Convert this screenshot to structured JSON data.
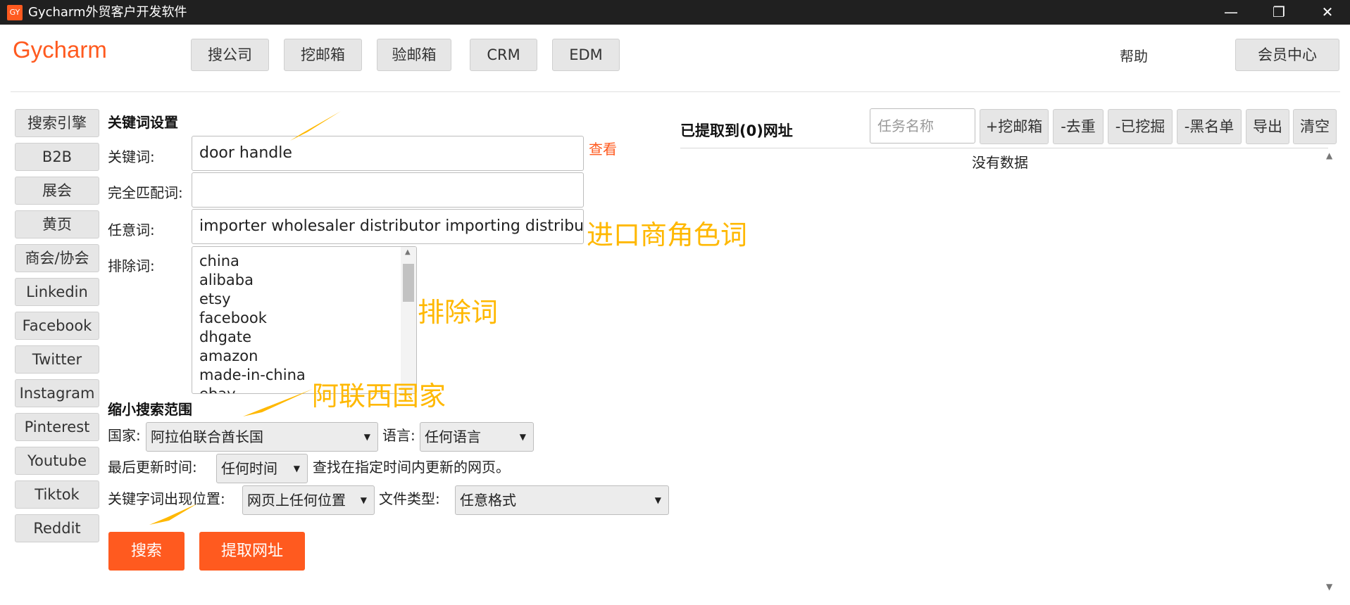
{
  "window": {
    "app_icon": "GY",
    "title": "Gycharm外贸客户开发软件",
    "controls": {
      "minimize": "—",
      "maximize": "❐",
      "close": "✕"
    }
  },
  "brand": "Gycharm",
  "nav": {
    "items": [
      "搜公司",
      "挖邮箱",
      "验邮箱",
      "CRM",
      "EDM"
    ],
    "help": "帮助",
    "member": "会员中心"
  },
  "sidebar": {
    "items": [
      "搜索引擎",
      "B2B",
      "展会",
      "黄页",
      "商会/协会",
      "Linkedin",
      "Facebook",
      "Twitter",
      "Instagram",
      "Pinterest",
      "Youtube",
      "Tiktok",
      "Reddit"
    ]
  },
  "keyword_settings": {
    "section_title": "关键词设置",
    "keyword_label": "关键词:",
    "keyword_value": "door handle",
    "view_link": "查看",
    "exact_label": "完全匹配词:",
    "exact_value": "",
    "any_label": "任意词:",
    "any_value": "importer wholesaler distributor importing distributing",
    "exclude_label": "排除词:",
    "exclude_items": [
      "china",
      "alibaba",
      "etsy",
      "facebook",
      "dhgate",
      "amazon",
      "made-in-china",
      "ebay"
    ]
  },
  "annotations": {
    "any_note": "进口商角色词",
    "exclude_note": "排除词",
    "country_note": "阿联西国家"
  },
  "narrow": {
    "section_title": "缩小搜索范围",
    "country_label": "国家:",
    "country_value": "阿拉伯联合酋长国",
    "language_label": "语言:",
    "language_value": "任何语言",
    "update_label": "最后更新时间:",
    "update_value": "任何时间",
    "update_hint": "查找在指定时间内更新的网页。",
    "position_label": "关键字词出现位置:",
    "position_value": "网页上任何位置",
    "filetype_label": "文件类型:",
    "filetype_value": "任意格式"
  },
  "actions": {
    "search": "搜索",
    "extract": "提取网址"
  },
  "results": {
    "title": "已提取到(0)网址",
    "task_placeholder": "任务名称",
    "buttons": [
      "+挖邮箱",
      "-去重",
      "-已挖掘",
      "-黑名单",
      "导出",
      "清空"
    ],
    "empty": "没有数据"
  },
  "colors": {
    "accent": "#ff5a1f",
    "annotation": "#ffb800",
    "titlebar": "#202020"
  }
}
